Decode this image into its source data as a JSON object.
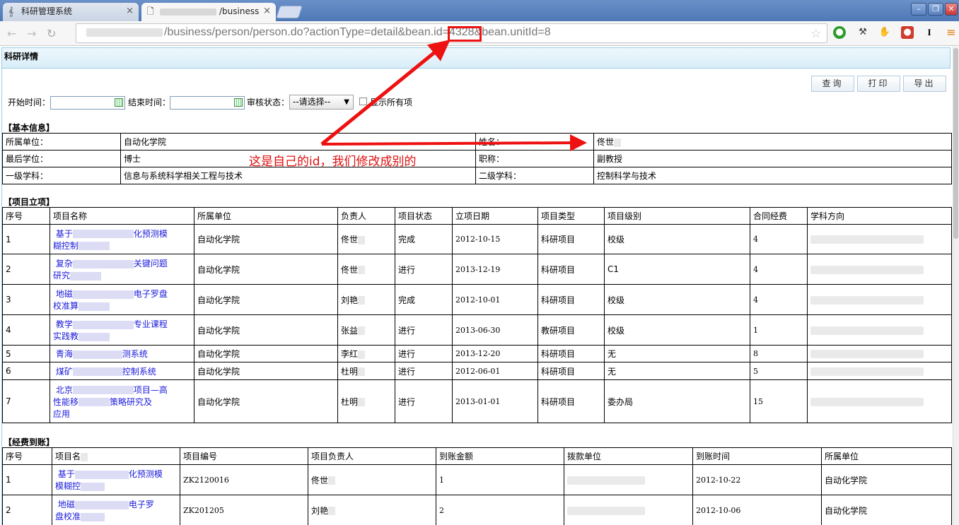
{
  "browser": {
    "tabs": [
      {
        "label": "科研管理系统",
        "close": "×",
        "active": false
      },
      {
        "label": "/business",
        "close": "×",
        "active": true
      }
    ],
    "url": {
      "prefix": "/business/person/person.do?actionType=detail&bean.id=",
      "id": "4328",
      "suffix": "&bean.unitId=8"
    },
    "window_controls": {
      "minimize": "–",
      "restore": "❐",
      "close": "✕"
    },
    "extension_icons": [
      "green-circle-icon",
      "wrench-icon",
      "glove-icon",
      "red-badge-icon",
      "cursor-i-icon",
      "menu-icon"
    ]
  },
  "page": {
    "panel_title": "科研详情",
    "buttons": {
      "query": "查询",
      "print": "打印",
      "export": "导出"
    },
    "filters": {
      "start_label": "开始时间：",
      "end_label": "结束时间：",
      "status_label": "审核状态：",
      "status_value": "--请选择--",
      "show_all_label": "显示所有项"
    },
    "basic_info": {
      "title": "【基本信息】",
      "rows": [
        {
          "k1": "所属单位：",
          "v1": "自动化学院",
          "k2": "姓名：",
          "v2": "佟世"
        },
        {
          "k1": "最后学位：",
          "v1": "博士",
          "k2": "职称：",
          "v2": "副教授"
        },
        {
          "k1": "一级学科：",
          "v1": "信息与系统科学相关工程与技术",
          "k2": "二级学科：",
          "v2": "控制科学与技术"
        }
      ]
    },
    "projects": {
      "title": "【项目立项】",
      "headers": [
        "序号",
        "项目名称",
        "所属单位",
        "负责人",
        "项目状态",
        "立项日期",
        "项目类型",
        "项目级别",
        "合同经费",
        "学科方向"
      ],
      "rows": [
        {
          "no": "1",
          "name_a": "基于",
          "name_b": "化预测模",
          "name_c": "糊控制",
          "unit": "自动化学院",
          "leader": "佟世",
          "status": "完成",
          "date": "2012-10-15",
          "type": "科研项目",
          "level": "校级",
          "fund": "4"
        },
        {
          "no": "2",
          "name_a": "复杂",
          "name_b": "关键问题",
          "name_c": "研究",
          "unit": "自动化学院",
          "leader": "佟世",
          "status": "进行",
          "date": "2013-12-19",
          "type": "科研项目",
          "level": "C1",
          "fund": "4"
        },
        {
          "no": "3",
          "name_a": "地磁",
          "name_b": "电子罗盘",
          "name_c": "校准算",
          "unit": "自动化学院",
          "leader": "刘艳",
          "status": "完成",
          "date": "2012-10-01",
          "type": "科研项目",
          "level": "校级",
          "fund": "4"
        },
        {
          "no": "4",
          "name_a": "教学",
          "name_b": "专业课程",
          "name_c": "实践教",
          "unit": "自动化学院",
          "leader": "张益",
          "status": "进行",
          "date": "2013-06-30",
          "type": "教研项目",
          "level": "校级",
          "fund": "1"
        },
        {
          "no": "5",
          "name_a": "青海",
          "name_b": "测系统",
          "name_c": "",
          "unit": "自动化学院",
          "leader": "李红",
          "status": "进行",
          "date": "2013-12-20",
          "type": "科研项目",
          "level": "无",
          "fund": "8"
        },
        {
          "no": "6",
          "name_a": "煤矿",
          "name_b": "控制系统",
          "name_c": "",
          "unit": "自动化学院",
          "leader": "杜明",
          "status": "进行",
          "date": "2012-06-01",
          "type": "科研项目",
          "level": "无",
          "fund": "5"
        },
        {
          "no": "7",
          "name_a": "北京",
          "name_b": "项目—高",
          "name_c": "性能移",
          "name_d": "策略研究及",
          "name_e": "应用",
          "unit": "自动化学院",
          "leader": "杜明",
          "status": "进行",
          "date": "2013-01-01",
          "type": "科研项目",
          "level": "委办局",
          "fund": "15"
        }
      ]
    },
    "funding": {
      "title": "【经费到账】",
      "headers": [
        "序号",
        "项目名",
        "项目编号",
        "项目负责人",
        "到账金额",
        "拨款单位",
        "到账时间",
        "所属单位"
      ],
      "rows": [
        {
          "no": "1",
          "name_a": "基于",
          "name_b": "化预测模",
          "name_c": "模糊控",
          "code": "ZK2120016",
          "leader": "佟世",
          "amount": "1",
          "date": "2012-10-22",
          "unit": "自动化学院"
        },
        {
          "no": "2",
          "name_a": "地磁",
          "name_b": "电子罗",
          "name_c": "盘校准",
          "code": "ZK201205",
          "leader": "刘艳",
          "amount": "2",
          "date": "2012-10-06",
          "unit": "自动化学院"
        }
      ]
    },
    "annotation": "这是自己的id，我们修改成别的",
    "colors": {
      "annotation": "#ee1111",
      "link": "#1a1adb",
      "panel_border": "#9ccde6"
    }
  }
}
